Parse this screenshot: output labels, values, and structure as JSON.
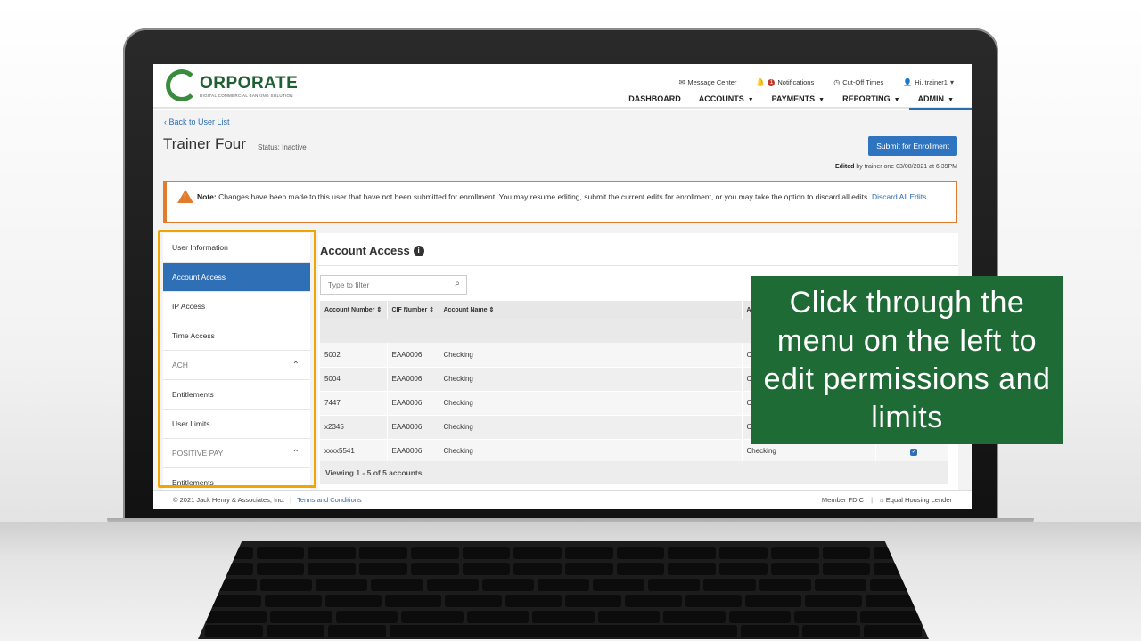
{
  "brand": {
    "title": "ORPORATE",
    "subtitle": "DIGITAL COMMERCIAL BANKING SOLUTION",
    "accent": "#1f5f33"
  },
  "utility": {
    "message_center": "Message Center",
    "notifications": "Notifications",
    "notifications_count": "1",
    "cutoff_times": "Cut-Off Times",
    "user_greeting": "Hi, trainer1"
  },
  "nav": {
    "dashboard": "DASHBOARD",
    "accounts": "ACCOUNTS",
    "payments": "PAYMENTS",
    "reporting": "REPORTING",
    "admin": "ADMIN"
  },
  "page": {
    "back_link": "Back to User List",
    "user_name": "Trainer Four",
    "status": "Status: Inactive",
    "submit_button": "Submit for Enrollment",
    "edited_prefix": "Edited",
    "edited_rest": "by trainer one 03/08/2021 at 6:39PM"
  },
  "alert": {
    "label": "Note:",
    "message": "Changes have been made to this user that have not been submitted for enrollment. You may resume editing, submit the current edits for enrollment, or you may take the option to discard all edits.",
    "link": "Discard All Edits"
  },
  "sidebar": {
    "items": [
      {
        "label": "User Information"
      },
      {
        "label": "Account Access"
      },
      {
        "label": "IP Access"
      },
      {
        "label": "Time Access"
      },
      {
        "label": "ACH"
      },
      {
        "label": "Entitlements"
      },
      {
        "label": "User Limits"
      },
      {
        "label": "POSITIVE PAY"
      },
      {
        "label": "Entitlements"
      }
    ]
  },
  "content": {
    "title": "Account Access",
    "filter_placeholder": "Type to filter",
    "columns": [
      "Account Number",
      "CIF Number",
      "Account Name",
      "A"
    ],
    "rows": [
      {
        "number": "5002",
        "cif": "EAA0006",
        "name": "Checking",
        "type": "C"
      },
      {
        "number": "5004",
        "cif": "EAA0006",
        "name": "Checking",
        "type": "C"
      },
      {
        "number": "7447",
        "cif": "EAA0006",
        "name": "Checking",
        "type": "C"
      },
      {
        "number": "x2345",
        "cif": "EAA0006",
        "name": "Checking",
        "type": "C"
      },
      {
        "number": "xxxx5541",
        "cif": "EAA0006",
        "name": "Checking",
        "type": "Checking"
      }
    ],
    "viewing": "Viewing 1 - 5 of 5 accounts"
  },
  "footer": {
    "copyright": "© 2021 Jack Henry & Associates, Inc.",
    "terms": "Terms and Conditions",
    "member_fdic": "Member FDIC",
    "equal_housing": "Equal Housing Lender"
  },
  "callout": {
    "text": "Click through the menu on the left to edit permissions and limits",
    "background": "#1e6b35"
  }
}
